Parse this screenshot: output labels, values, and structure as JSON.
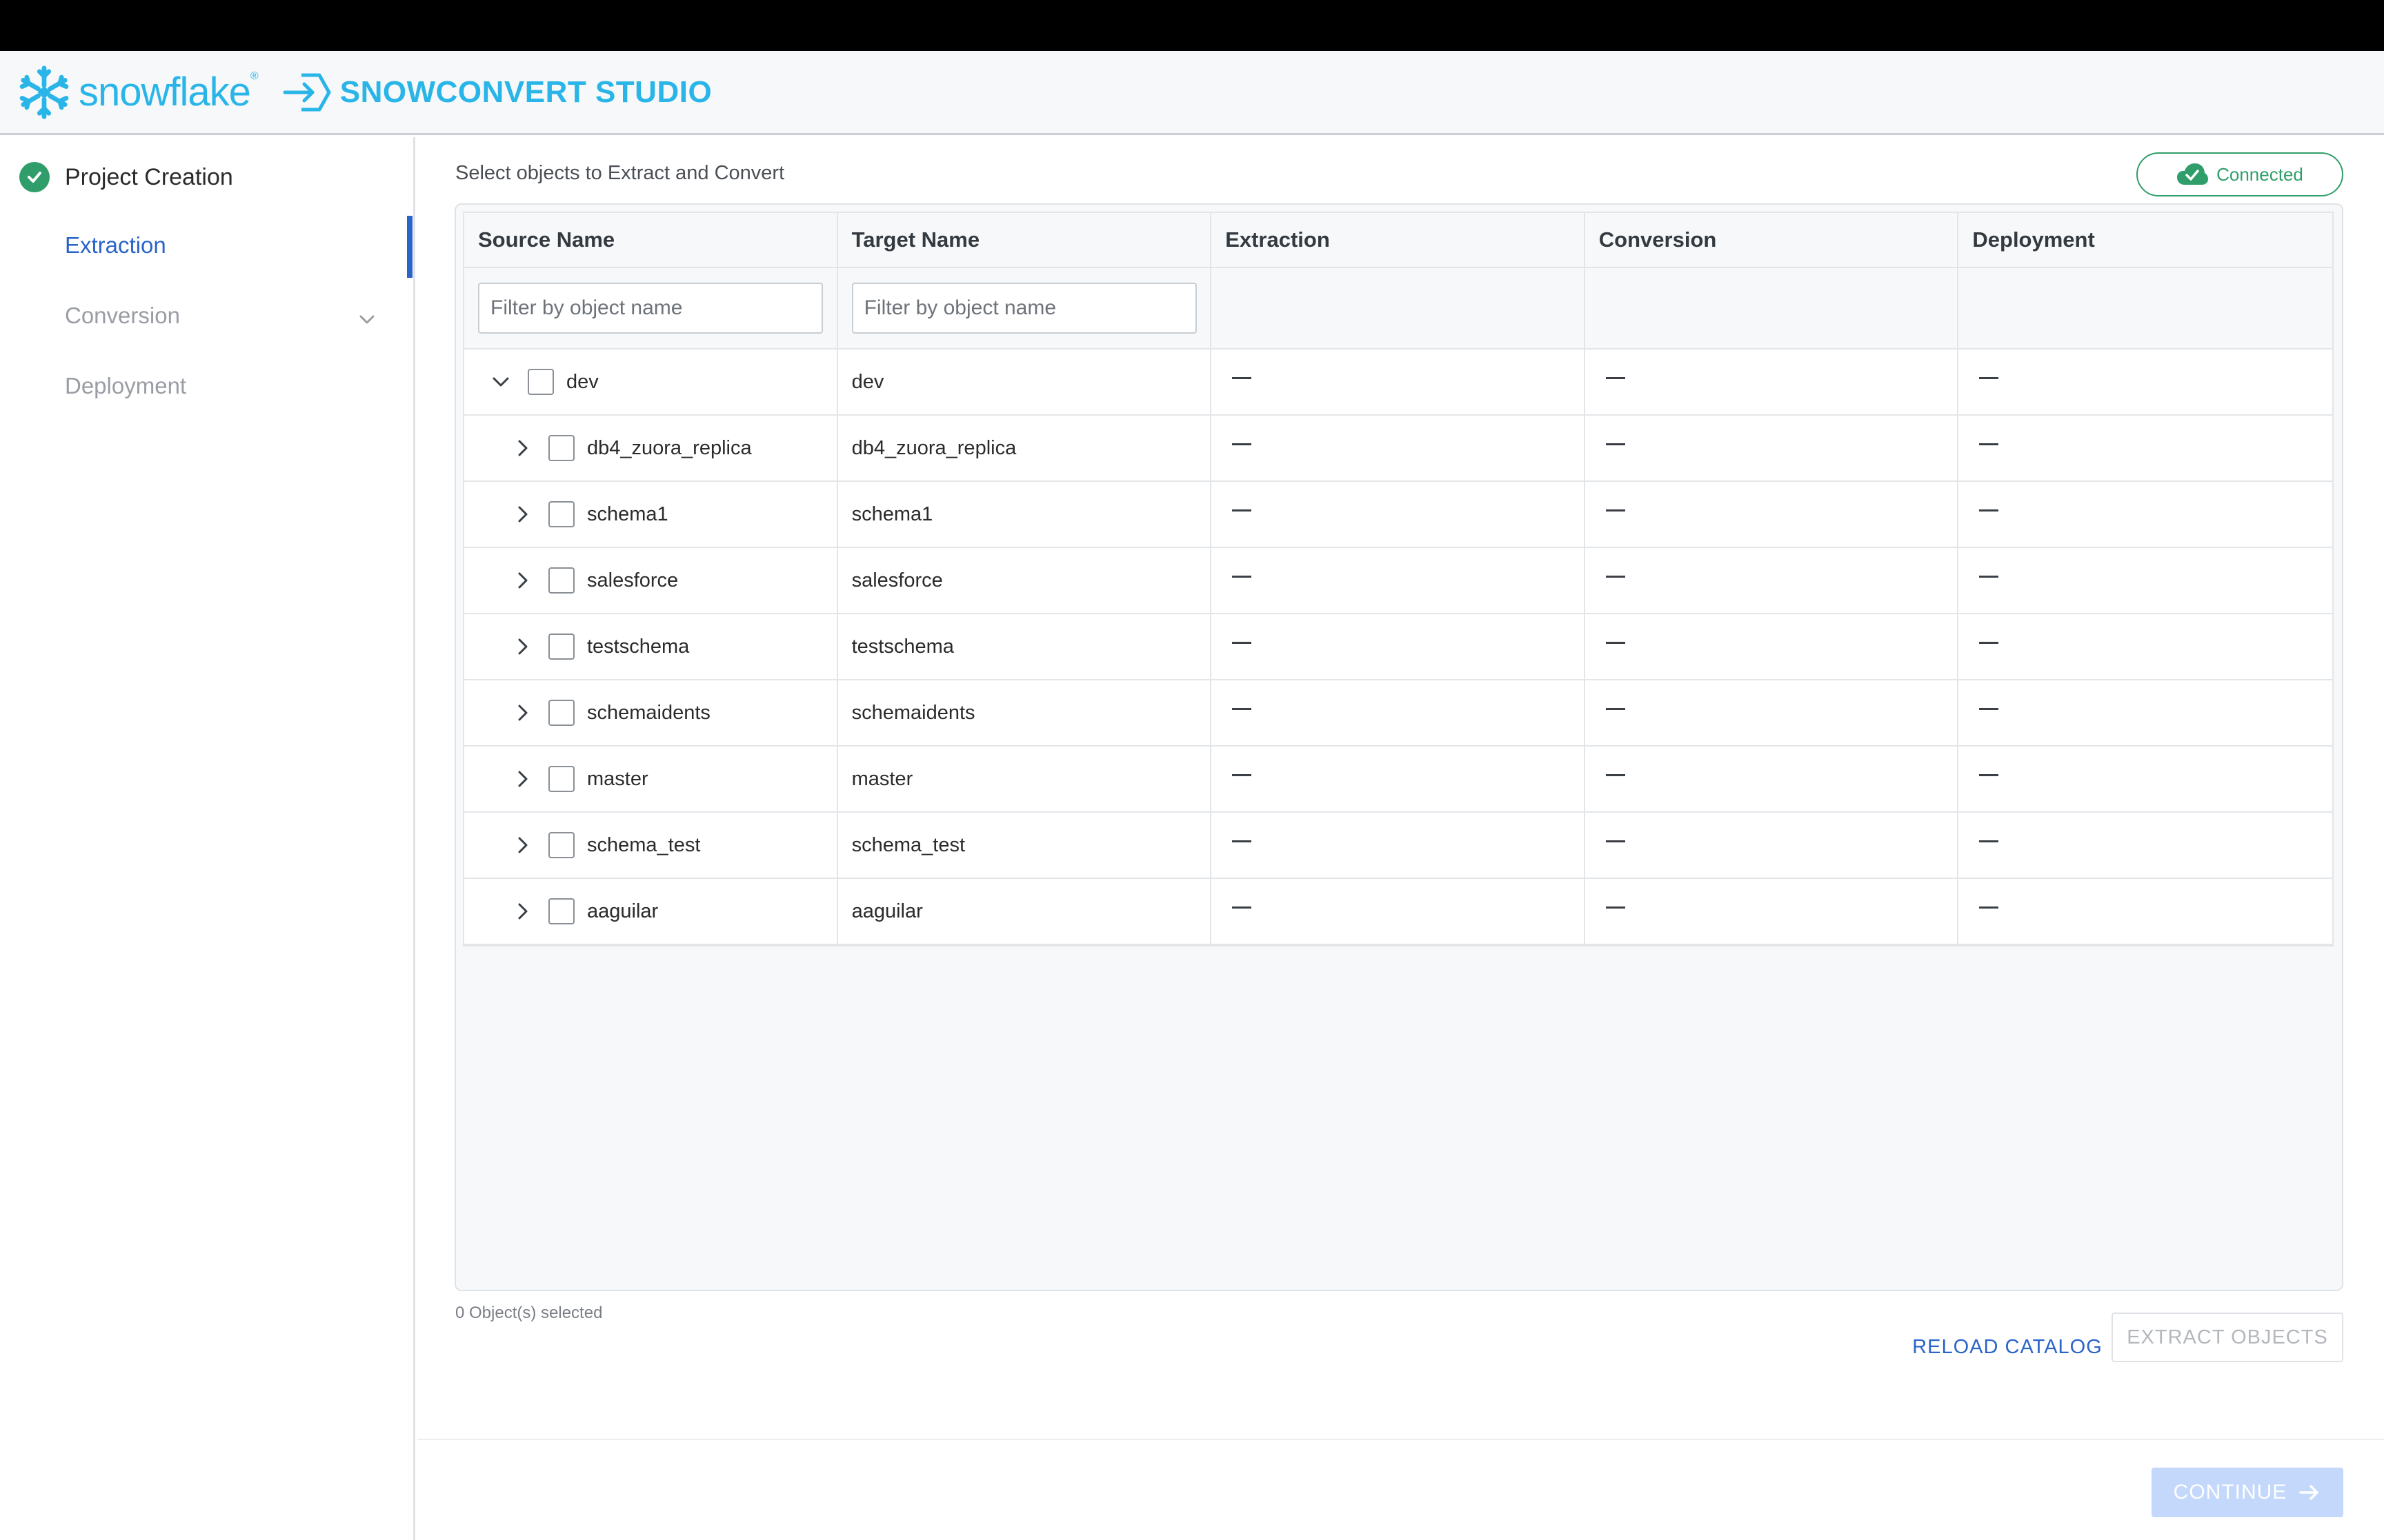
{
  "brand": {
    "logo_text": "snowflake",
    "logo_reg": "®",
    "product_name": "SNOWCONVERT STUDIO",
    "accent_color": "#29b5e8"
  },
  "sidebar": {
    "completed_step": "Project Creation",
    "items": [
      {
        "label": "Extraction",
        "state": "active"
      },
      {
        "label": "Conversion",
        "state": "disabled"
      },
      {
        "label": "Deployment",
        "state": "disabled"
      }
    ]
  },
  "main": {
    "subtitle": "Select objects to Extract and Convert",
    "status_badge": {
      "label": "Connected",
      "icon": "cloud-check-icon",
      "color": "#2f9e6a"
    },
    "table": {
      "columns": [
        "Source Name",
        "Target Name",
        "Extraction",
        "Conversion",
        "Deployment"
      ],
      "filter_placeholder_source": "Filter by object name",
      "filter_placeholder_target": "Filter by object name",
      "rows": [
        {
          "source": "dev",
          "target": "dev",
          "expanded": true,
          "level": 0
        },
        {
          "source": "db4_zuora_replica",
          "target": "db4_zuora_replica",
          "expanded": false,
          "level": 1
        },
        {
          "source": "schema1",
          "target": "schema1",
          "expanded": false,
          "level": 1
        },
        {
          "source": "salesforce",
          "target": "salesforce",
          "expanded": false,
          "level": 1
        },
        {
          "source": "testschema",
          "target": "testschema",
          "expanded": false,
          "level": 1
        },
        {
          "source": "schemaidents",
          "target": "schemaidents",
          "expanded": false,
          "level": 1
        },
        {
          "source": "master",
          "target": "master",
          "expanded": false,
          "level": 1
        },
        {
          "source": "schema_test",
          "target": "schema_test",
          "expanded": false,
          "level": 1
        },
        {
          "source": "aaguilar",
          "target": "aaguilar",
          "expanded": false,
          "level": 1
        }
      ]
    },
    "selected_count": "0 Object(s) selected",
    "reload_label": "RELOAD CATALOG",
    "extract_label": "EXTRACT OBJECTS",
    "continue_label": "CONTINUE"
  }
}
